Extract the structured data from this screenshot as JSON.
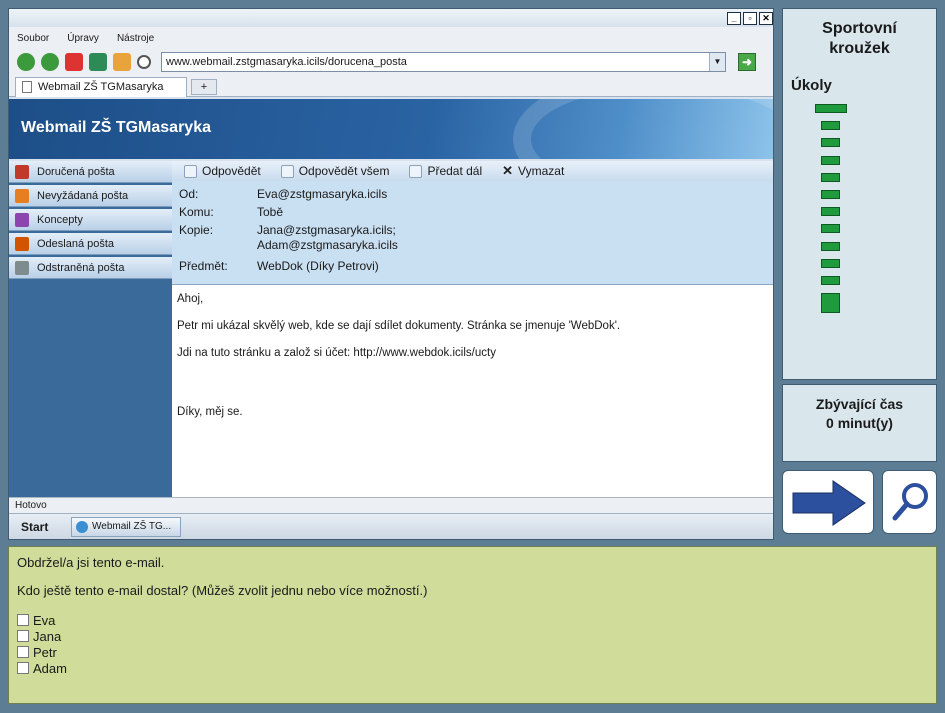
{
  "menubar": {
    "items": [
      "Soubor",
      "Úpravy",
      "Nástroje"
    ]
  },
  "address": {
    "url": "www.webmail.zstgmasaryka.icils/dorucena_posta"
  },
  "tabs": {
    "active_label": "Webmail ZŠ TGMasaryka",
    "new_tab_label": "+"
  },
  "banner": {
    "title": "Webmail ZŠ TGMasaryka"
  },
  "sidebar": {
    "items": [
      {
        "label": "Doručená pošta",
        "color": "#c0392b"
      },
      {
        "label": "Nevyžádaná pošta",
        "color": "#e67e22"
      },
      {
        "label": "Koncepty",
        "color": "#8e44ad"
      },
      {
        "label": "Odeslaná pošta",
        "color": "#d35400"
      },
      {
        "label": "Odstraněná pošta",
        "color": "#7f8c8d"
      }
    ]
  },
  "toolbar": {
    "reply": "Odpovědět",
    "reply_all": "Odpovědět všem",
    "forward": "Předat dál",
    "delete": "Vymazat"
  },
  "email": {
    "from_label": "Od:",
    "from": "Eva@zstgmasaryka.icils",
    "to_label": "Komu:",
    "to": "Tobě",
    "cc_label": "Kopie:",
    "cc_1": "Jana@zstgmasaryka.icils;",
    "cc_2": "Adam@zstgmasaryka.icils",
    "subject_label": "Předmět:",
    "subject": "WebDok (Díky Petrovi)",
    "body": [
      "Ahoj,",
      "Petr mi ukázal skvělý web, kde se dají sdílet dokumenty. Stránka se jmenuje 'WebDok'.",
      "Jdi na tuto stránku a založ si účet: http://www.webdok.icils/ucty",
      "Díky, měj se."
    ]
  },
  "statusbar": {
    "text": "Hotovo"
  },
  "taskbar": {
    "start": "Start",
    "item": "Webmail ZŠ TG..."
  },
  "tasks_panel": {
    "title_line1": "Sportovní",
    "title_line2": "kroužek",
    "label": "Úkoly",
    "total_tasks": 12,
    "current_task": 12
  },
  "time_panel": {
    "line1": "Zbývající čas",
    "line2": "0 minut(y)"
  },
  "question": {
    "intro": "Obdržel/a jsi tento e-mail.",
    "prompt": "Kdo ještě tento e-mail dostal? (Můžeš zvolit jednu nebo více možností.)",
    "options": [
      "Eva",
      "Jana",
      "Petr",
      "Adam"
    ]
  }
}
